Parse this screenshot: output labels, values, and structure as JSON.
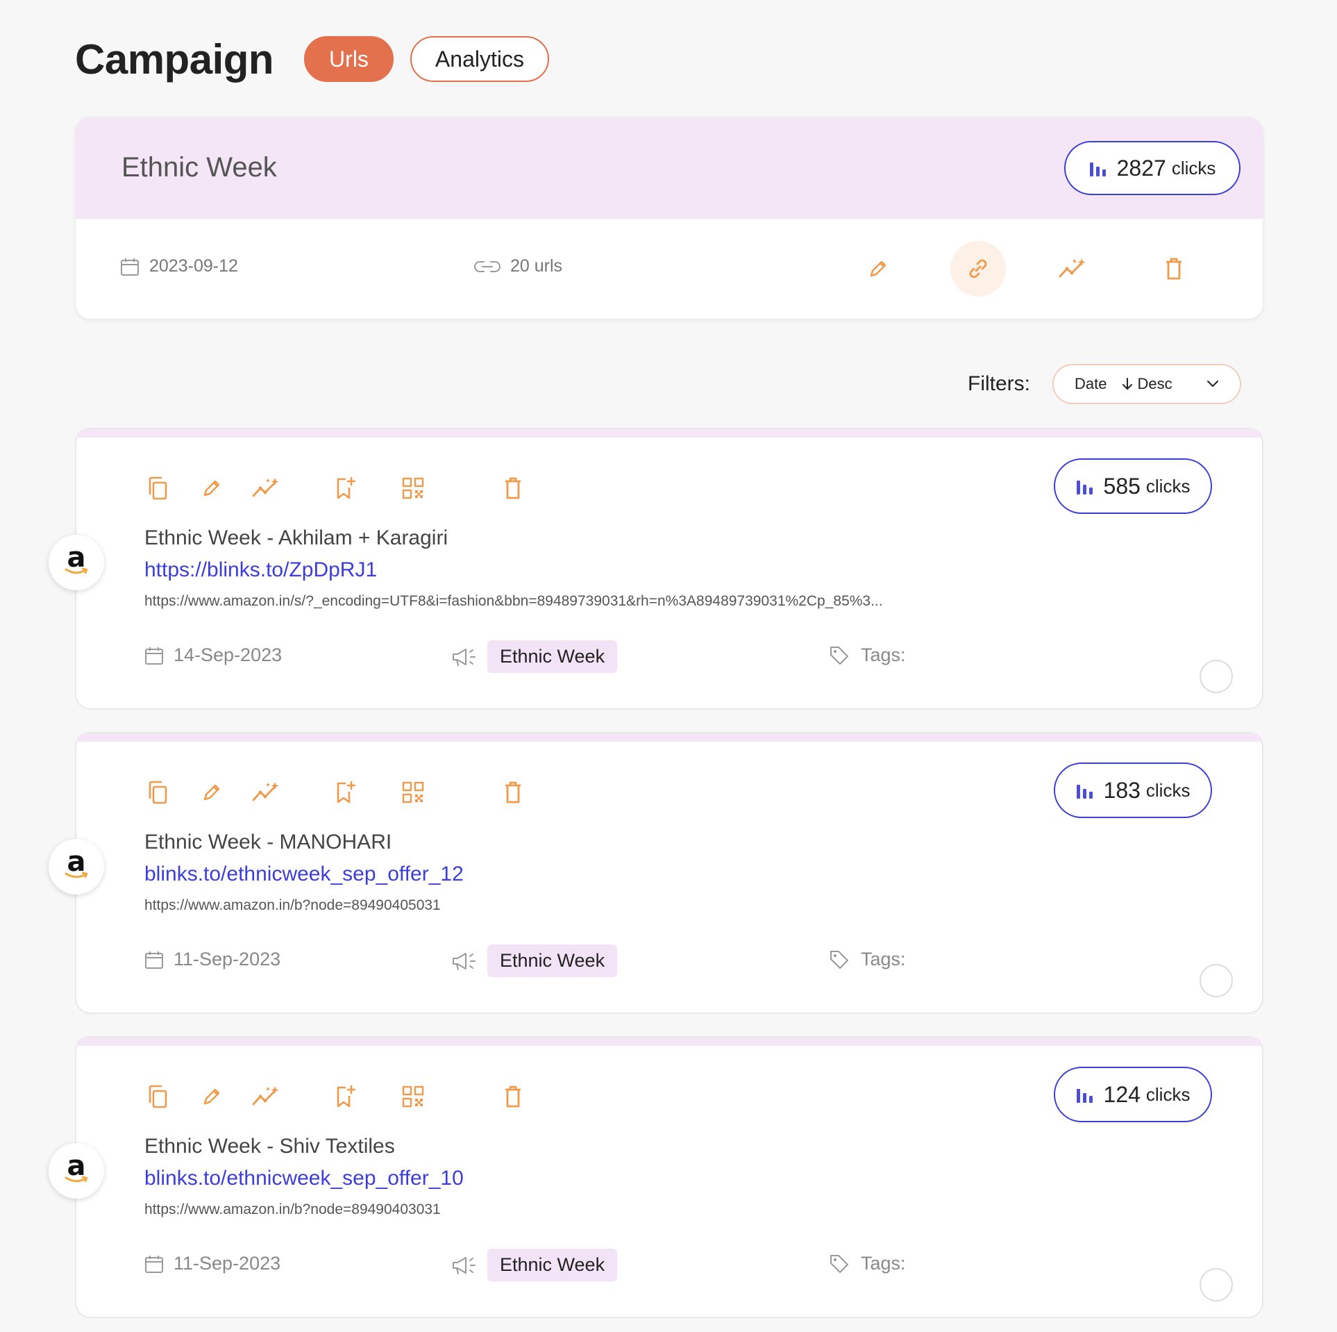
{
  "header": {
    "title": "Campaign",
    "tabs": [
      {
        "label": "Urls",
        "active": true
      },
      {
        "label": "Analytics",
        "active": false
      }
    ]
  },
  "campaign": {
    "name": "Ethnic Week",
    "clicks": "2827",
    "clicks_label": "clicks",
    "date": "2023-09-12",
    "urls_count": "20 urls",
    "actions": [
      "pencil-icon",
      "link-icon",
      "sparkle-chart-icon",
      "trash-icon"
    ]
  },
  "filters": {
    "label": "Filters:",
    "sort_field": "Date",
    "sort_order": "Desc"
  },
  "urls": [
    {
      "title": "Ethnic Week - Akhilam + Karagiri",
      "short_link": "https://blinks.to/ZpDpRJ1",
      "long_url": "https://www.amazon.in/s/?_encoding=UTF8&i=fashion&bbn=89489739031&rh=n%3A89489739031%2Cp_85%3...",
      "clicks": "585",
      "clicks_label": "clicks",
      "date": "14-Sep-2023",
      "campaign": "Ethnic Week",
      "tags_label": "Tags:",
      "logo": "a"
    },
    {
      "title": "Ethnic Week - MANOHARI",
      "short_link": "blinks.to/ethnicweek_sep_offer_12",
      "long_url": "https://www.amazon.in/b?node=89490405031",
      "clicks": "183",
      "clicks_label": "clicks",
      "date": "11-Sep-2023",
      "campaign": "Ethnic Week",
      "tags_label": "Tags:",
      "logo": "a"
    },
    {
      "title": "Ethnic Week - Shiv Textiles",
      "short_link": "blinks.to/ethnicweek_sep_offer_10",
      "long_url": "https://www.amazon.in/b?node=89490403031",
      "clicks": "124",
      "clicks_label": "clicks",
      "date": "11-Sep-2023",
      "campaign": "Ethnic Week",
      "tags_label": "Tags:",
      "logo": "a"
    }
  ],
  "colors": {
    "accent": "#e4714e",
    "icon_orange": "#ef9a4a",
    "link_blue": "#3b3ed8",
    "campaign_band": "#f4e6f6"
  }
}
